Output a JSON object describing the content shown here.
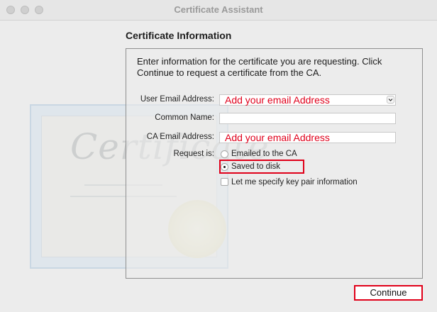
{
  "window": {
    "title": "Certificate Assistant"
  },
  "section": {
    "heading": "Certificate Information",
    "intro": "Enter information for the certificate you are requesting. Click Continue to request a certificate from the CA."
  },
  "form": {
    "user_email_label": "User Email Address:",
    "user_email_value": "Add your email Address",
    "common_name_label": "Common Name:",
    "common_name_value": "",
    "ca_email_label": "CA Email Address:",
    "ca_email_value": "Add your email Address",
    "request_label": "Request is:",
    "option_emailed": "Emailed to the CA",
    "option_saved": "Saved to disk",
    "selected_option": "Saved to disk",
    "key_pair_checkbox": "Let me specify key pair information",
    "key_pair_checked": false
  },
  "certificate_art": {
    "word": "Certificate"
  },
  "buttons": {
    "continue": "Continue"
  },
  "colors": {
    "annotation_red": "#e00019",
    "window_bg": "#ececec"
  }
}
